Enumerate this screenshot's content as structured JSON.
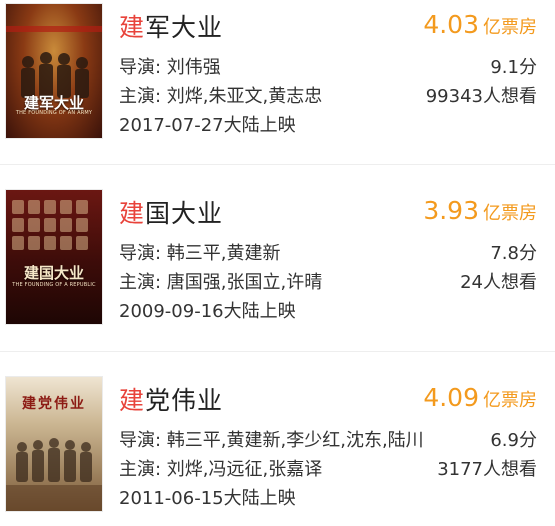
{
  "movies": [
    {
      "title_highlight": "建",
      "title_rest": "军大业",
      "box_value": "4.03",
      "box_unit": "亿票房",
      "director_line": "导演: 刘伟强",
      "rating": "9.1分",
      "cast_line": "主演: 刘烨,朱亚文,黄志忠",
      "wants": "99343人想看",
      "release_line": "2017-07-27大陆上映",
      "poster_title": "建军大业",
      "poster_subtitle": "THE FOUNDING OF AN ARMY"
    },
    {
      "title_highlight": "建",
      "title_rest": "国大业",
      "box_value": "3.93",
      "box_unit": "亿票房",
      "director_line": "导演: 韩三平,黄建新",
      "rating": "7.8分",
      "cast_line": "主演: 唐国强,张国立,许晴",
      "wants": "24人想看",
      "release_line": "2009-09-16大陆上映",
      "poster_title": "建国大业",
      "poster_subtitle": "THE FOUNDING OF A REPUBLIC"
    },
    {
      "title_highlight": "建",
      "title_rest": "党伟业",
      "box_value": "4.09",
      "box_unit": "亿票房",
      "director_line": "导演: 韩三平,黄建新,李少红,沈东,陆川",
      "rating": "6.9分",
      "cast_line": "主演: 刘烨,冯远征,张嘉译",
      "wants": "3177人想看",
      "release_line": "2011-06-15大陆上映",
      "poster_title": "建党伟业",
      "poster_subtitle": ""
    }
  ],
  "colors": {
    "highlight": "#e8433b",
    "box_office": "#f39a1e",
    "text": "#333333"
  }
}
